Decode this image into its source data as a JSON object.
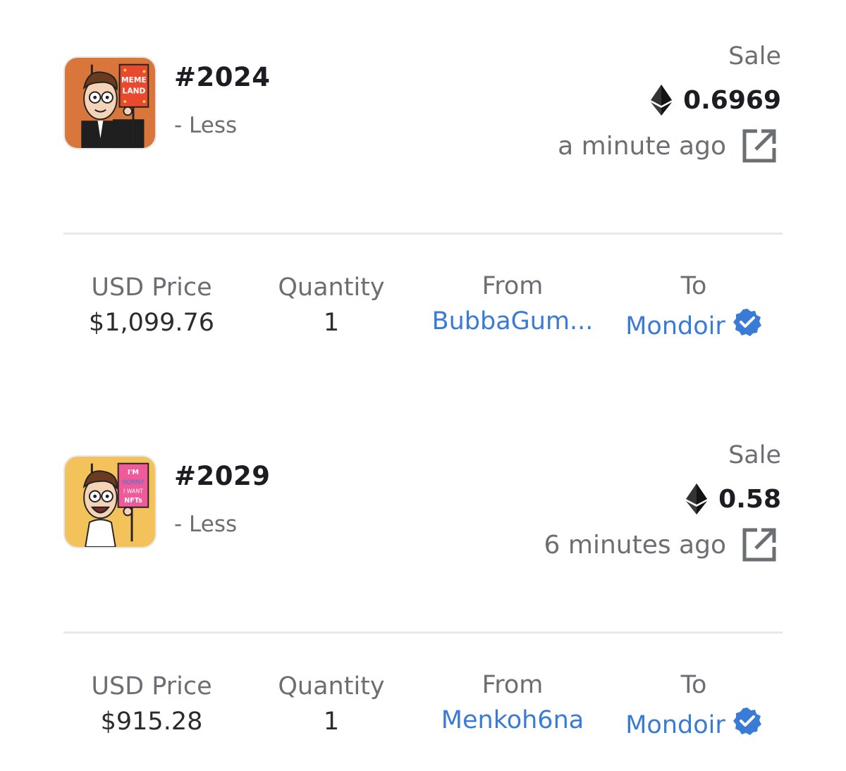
{
  "transactions": [
    {
      "token": "#2024",
      "toggle": "- Less",
      "event": "Sale",
      "eth_price": "0.6969",
      "time": "a minute ago",
      "thumb_bg": "#d8763c",
      "sign_lines": [
        "MEME",
        "LAND"
      ],
      "usd_label": "USD Price",
      "usd_value": "$1,099.76",
      "qty_label": "Quantity",
      "qty_value": "1",
      "from_label": "From",
      "from_value": "BubbaGum...",
      "to_label": "To",
      "to_value": "Mondoir"
    },
    {
      "token": "#2029",
      "toggle": "- Less",
      "event": "Sale",
      "eth_price": "0.58",
      "time": "6 minutes ago",
      "thumb_bg": "#f4c25a",
      "sign_lines": [
        "I'M",
        "HORNY",
        "I WANT",
        "NFTs"
      ],
      "usd_label": "USD Price",
      "usd_value": "$915.28",
      "qty_label": "Quantity",
      "qty_value": "1",
      "from_label": "From",
      "from_value": "Menkoh6na",
      "to_label": "To",
      "to_value": "Mondoir"
    }
  ],
  "colors": {
    "link": "#3a7bd5",
    "muted": "#6b6e73",
    "verified": "#3a7bd5"
  }
}
